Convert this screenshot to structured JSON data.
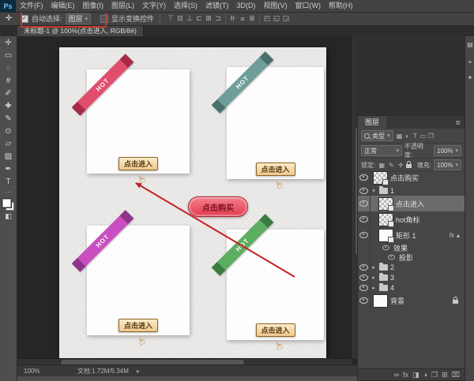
{
  "app": {
    "logo": "Ps",
    "menus": [
      "文件(F)",
      "编辑(E)",
      "图像(I)",
      "图层(L)",
      "文字(Y)",
      "选择(S)",
      "滤镜(T)",
      "3D(D)",
      "视图(V)",
      "窗口(W)",
      "帮助(H)"
    ]
  },
  "options_bar": {
    "move_tool_glyph": "✛",
    "auto_select_label": "自动选择:",
    "auto_select_value": "图层",
    "auto_select_checked": "✓",
    "show_transform_label": "显示变换控件",
    "annotation_box_color": "#c63b2f",
    "align_icons": [
      {
        "name": "align-top-edges-icon",
        "glyph": "⊤"
      },
      {
        "name": "align-vertical-centers-icon",
        "glyph": "⊟"
      },
      {
        "name": "align-bottom-edges-icon",
        "glyph": "⊥"
      },
      {
        "name": "align-left-edges-icon",
        "glyph": "⊏"
      },
      {
        "name": "align-horizontal-centers-icon",
        "glyph": "⊞"
      },
      {
        "name": "align-right-edges-icon",
        "glyph": "⊐"
      }
    ],
    "distribute_icons": [
      {
        "name": "distribute-top-edges-icon",
        "glyph": "⊪"
      },
      {
        "name": "distribute-vertical-centers-icon",
        "glyph": "≡"
      },
      {
        "name": "distribute-bottom-edges-icon",
        "glyph": "≣"
      }
    ],
    "mode_icons": [
      {
        "name": "3d-mode-rotate-icon",
        "glyph": "◰"
      },
      {
        "name": "3d-mode-roll-icon",
        "glyph": "◱"
      },
      {
        "name": "3d-mode-drag-icon",
        "glyph": "◲"
      }
    ]
  },
  "document_tab": {
    "title": "未标题-1 @ 100%(点击进入, RGB/8#)"
  },
  "toolbar": {
    "more_glyph": "…",
    "tools": [
      {
        "name": "move-tool",
        "glyph": "✛"
      },
      {
        "name": "rectangular-marquee-tool",
        "glyph": "▭"
      },
      {
        "name": "lasso-tool",
        "glyph": "◌"
      },
      {
        "name": "crop-tool",
        "glyph": "#"
      },
      {
        "name": "eyedropper-tool",
        "glyph": "✐"
      },
      {
        "name": "healing-brush-tool",
        "glyph": "✚"
      },
      {
        "name": "brush-tool",
        "glyph": "✎"
      },
      {
        "name": "clone-stamp-tool",
        "glyph": "⊙"
      },
      {
        "name": "eraser-tool",
        "glyph": "▱"
      },
      {
        "name": "gradient-tool",
        "glyph": "▨"
      },
      {
        "name": "pen-tool",
        "glyph": "✒"
      },
      {
        "name": "type-tool",
        "glyph": "T"
      }
    ]
  },
  "canvas": {
    "cards": [
      {
        "position": "top-left",
        "ribbon_text": "HOT",
        "ribbon_color": "#e14e6d",
        "ribbon_fold_color": "#a82a49",
        "button_label": "点击进入"
      },
      {
        "position": "top-right",
        "ribbon_text": "HOT",
        "ribbon_color": "#6f9e9a",
        "ribbon_fold_color": "#48706d",
        "button_label": "点击进入"
      },
      {
        "position": "bottom-left",
        "ribbon_text": "HOT",
        "ribbon_color": "#c94fc0",
        "ribbon_fold_color": "#8f338a",
        "button_label": "点击进入"
      },
      {
        "position": "bottom-right",
        "ribbon_text": "HOT",
        "ribbon_color": "#5cad60",
        "ribbon_fold_color": "#3b7b40",
        "button_label": "点击进入"
      }
    ],
    "buy_button": {
      "label": "点击购买",
      "bg_top": "#f3808b",
      "bg_bottom": "#e23c51",
      "border_color": "#b02238",
      "text_color": "#7e1020"
    },
    "annotation_line_color": "#c42222"
  },
  "layers_panel": {
    "title": "图层",
    "panel_menu_glyph": "≣",
    "filter": {
      "search_label": "类型",
      "caret": "▾",
      "icons": [
        {
          "name": "filter-pixel-layers-icon",
          "glyph": "▦"
        },
        {
          "name": "filter-adjustment-layers-icon",
          "glyph": "◐"
        },
        {
          "name": "filter-type-layers-icon",
          "glyph": "T"
        },
        {
          "name": "filter-shape-layers-icon",
          "glyph": "▭"
        },
        {
          "name": "filter-smart-objects-icon",
          "glyph": "❒"
        }
      ]
    },
    "blend_mode_value": "正常",
    "opacity_label": "不透明度:",
    "opacity_value": "100%",
    "lock_label": "锁定:",
    "lock_icons": [
      {
        "name": "lock-transparent-pixels-icon",
        "glyph": "▦"
      },
      {
        "name": "lock-image-pixels-icon",
        "glyph": "✎"
      },
      {
        "name": "lock-position-icon",
        "glyph": "✛"
      },
      {
        "name": "lock-all-icon",
        "glyph": "css-lock"
      }
    ],
    "fill_label": "填充:",
    "fill_value": "100%",
    "fx_label": "fx",
    "fx_collapse_glyph": "▴",
    "expand_open_glyph": "▾",
    "expand_closed_glyph": "▸",
    "layers": [
      {
        "name": "点击购买",
        "kind": "layer",
        "indent": 0,
        "selected": false,
        "badge": true
      },
      {
        "name": "1",
        "kind": "group-open",
        "indent": 0
      },
      {
        "name": "点击进入",
        "kind": "layer",
        "indent": 1,
        "selected": true,
        "badge": true
      },
      {
        "name": "hot角标",
        "kind": "layer",
        "indent": 1,
        "badge": true
      },
      {
        "name": "矩形 1",
        "kind": "layer",
        "indent": 1,
        "badge": true,
        "fx": true,
        "thumb": "white"
      },
      {
        "name": "效果",
        "kind": "effect",
        "indent": 2
      },
      {
        "name": "投影",
        "kind": "effect",
        "indent": 3
      },
      {
        "name": "2",
        "kind": "group",
        "indent": 0
      },
      {
        "name": "3",
        "kind": "group",
        "indent": 0
      },
      {
        "name": "4",
        "kind": "group",
        "indent": 0
      },
      {
        "name": "背景",
        "kind": "background",
        "indent": 0,
        "locked": true
      }
    ],
    "footer_icons": [
      {
        "name": "link-layers-icon",
        "glyph": "∞"
      },
      {
        "name": "layer-effects-icon",
        "glyph": "fx"
      },
      {
        "name": "layer-mask-icon",
        "glyph": "◨"
      },
      {
        "name": "adjustment-layer-icon",
        "glyph": "◑"
      },
      {
        "name": "layer-group-icon",
        "glyph": "❒"
      },
      {
        "name": "new-layer-icon",
        "glyph": "⊞"
      },
      {
        "name": "delete-layer-icon",
        "glyph": "⌧"
      }
    ]
  },
  "status_bar": {
    "zoom_level": "100%",
    "doc_info": "文档:1.72M/5.34M",
    "arrow_glyph": "▸"
  },
  "right_strip": {
    "icons": [
      {
        "name": "color-panel-icon",
        "glyph": "▤"
      },
      {
        "name": "adjustments-panel-icon",
        "glyph": "◒"
      },
      {
        "name": "styles-panel-icon",
        "glyph": "✦"
      }
    ]
  }
}
